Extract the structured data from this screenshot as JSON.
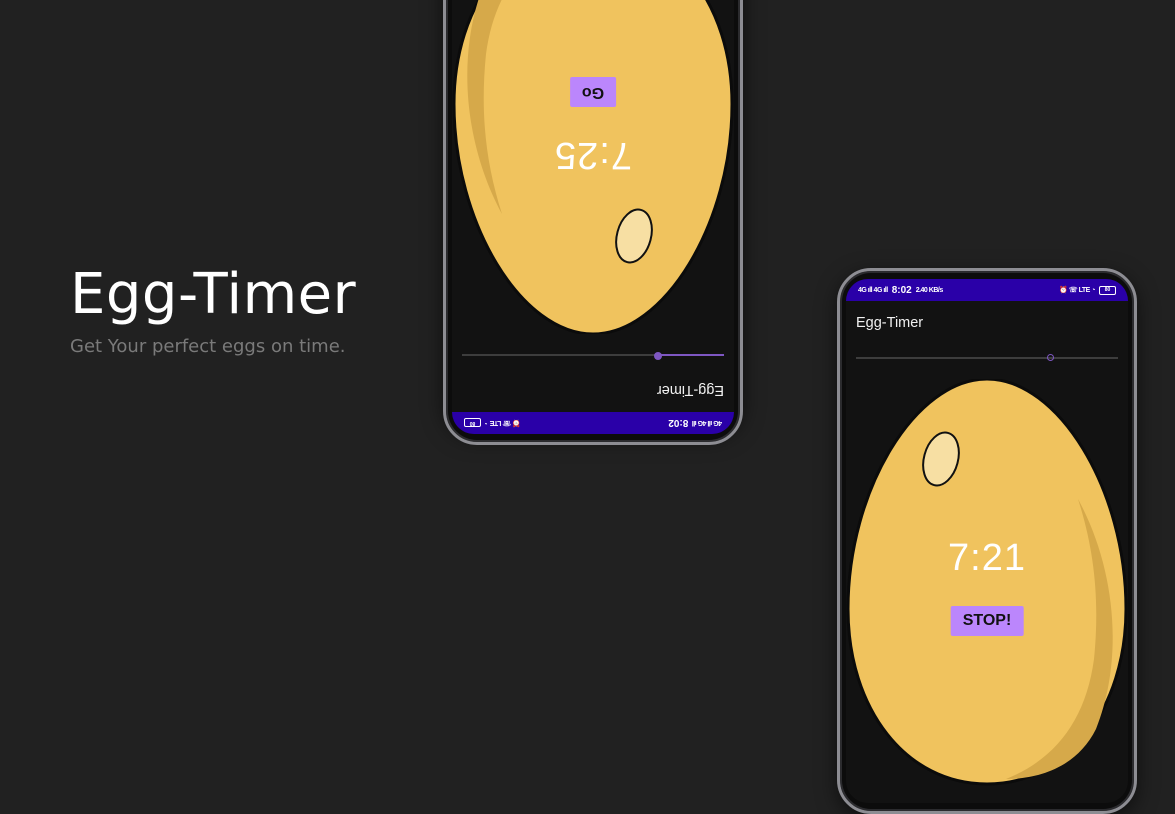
{
  "hero": {
    "title": "Egg-Timer",
    "subtitle": "Get Your perfect eggs on time."
  },
  "phones": [
    {
      "status": {
        "time": "8:02",
        "left_signal": "4G ıll 4G ıll",
        "right_icons": "⏰ ☏ LTE ◔",
        "battery": "80"
      },
      "app_title": "Egg-Timer",
      "slider_value": 0.25,
      "timer": "7:25",
      "button_label": "Go"
    },
    {
      "status": {
        "time": "8:02",
        "left_signal": "4G ıll 4G ıll",
        "speed": "2.40 KB/s",
        "right_icons": "⏰ ☏ LTE ◔",
        "battery": "80"
      },
      "app_title": "Egg-Timer",
      "slider_value": 0.74,
      "timer": "7:21",
      "button_label": "STOP!"
    }
  ],
  "colors": {
    "background": "#212121",
    "status_bar": "#2a00a8",
    "accent": "#bb86fc",
    "egg": "#f0c35e",
    "egg_shadow": "#d6a94a",
    "egg_highlight": "#f7dfa3"
  }
}
